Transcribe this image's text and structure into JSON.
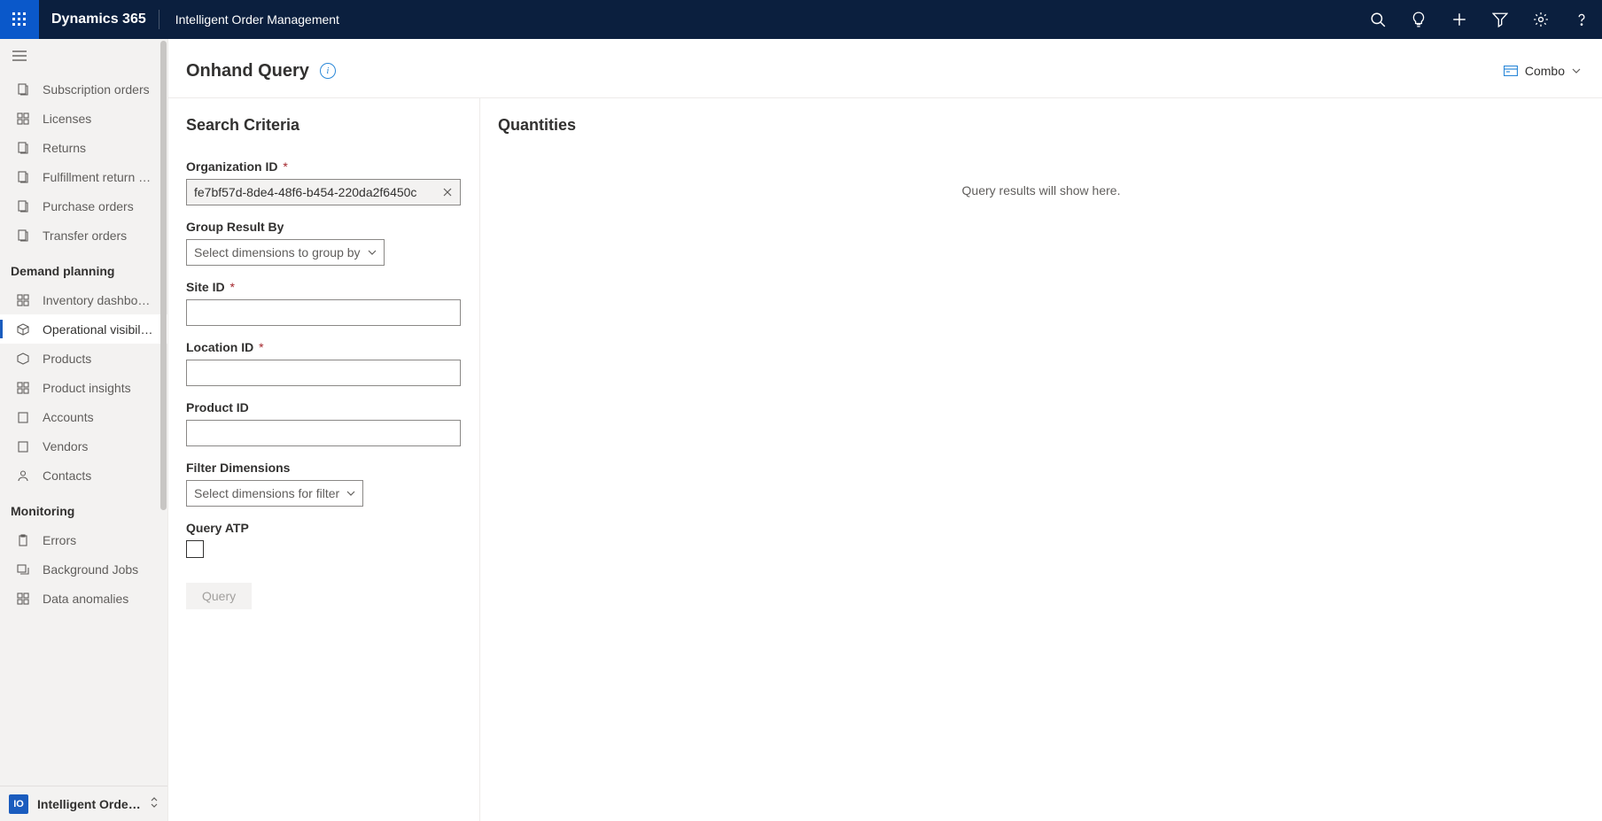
{
  "topbar": {
    "brand": "Dynamics 365",
    "app": "Intelligent Order Management"
  },
  "sidebar": {
    "items_top": [
      {
        "label": "Subscription orders"
      },
      {
        "label": "Licenses"
      },
      {
        "label": "Returns"
      },
      {
        "label": "Fulfillment return …"
      },
      {
        "label": "Purchase orders"
      },
      {
        "label": "Transfer orders"
      }
    ],
    "group_demand_title": "Demand planning",
    "items_demand": [
      {
        "label": "Inventory dashbo…"
      },
      {
        "label": "Operational visibil…",
        "selected": true
      },
      {
        "label": "Products"
      },
      {
        "label": "Product insights"
      },
      {
        "label": "Accounts"
      },
      {
        "label": "Vendors"
      },
      {
        "label": "Contacts"
      }
    ],
    "group_monitoring_title": "Monitoring",
    "items_monitoring": [
      {
        "label": "Errors"
      },
      {
        "label": "Background Jobs"
      },
      {
        "label": "Data anomalies"
      }
    ],
    "switcher": {
      "chip": "IO",
      "label": "Intelligent Order …"
    }
  },
  "page": {
    "title": "Onhand Query",
    "combo_label": "Combo"
  },
  "search": {
    "section_title": "Search Criteria",
    "org_label": "Organization ID",
    "org_value": "fe7bf57d-8de4-48f6-b454-220da2f6450c",
    "group_label": "Group Result By",
    "group_placeholder": "Select dimensions to group by",
    "site_label": "Site ID",
    "location_label": "Location ID",
    "product_label": "Product ID",
    "filter_label": "Filter Dimensions",
    "filter_placeholder": "Select dimensions for filter",
    "atp_label": "Query ATP",
    "query_button": "Query"
  },
  "quantities": {
    "section_title": "Quantities",
    "empty_text": "Query results will show here."
  }
}
